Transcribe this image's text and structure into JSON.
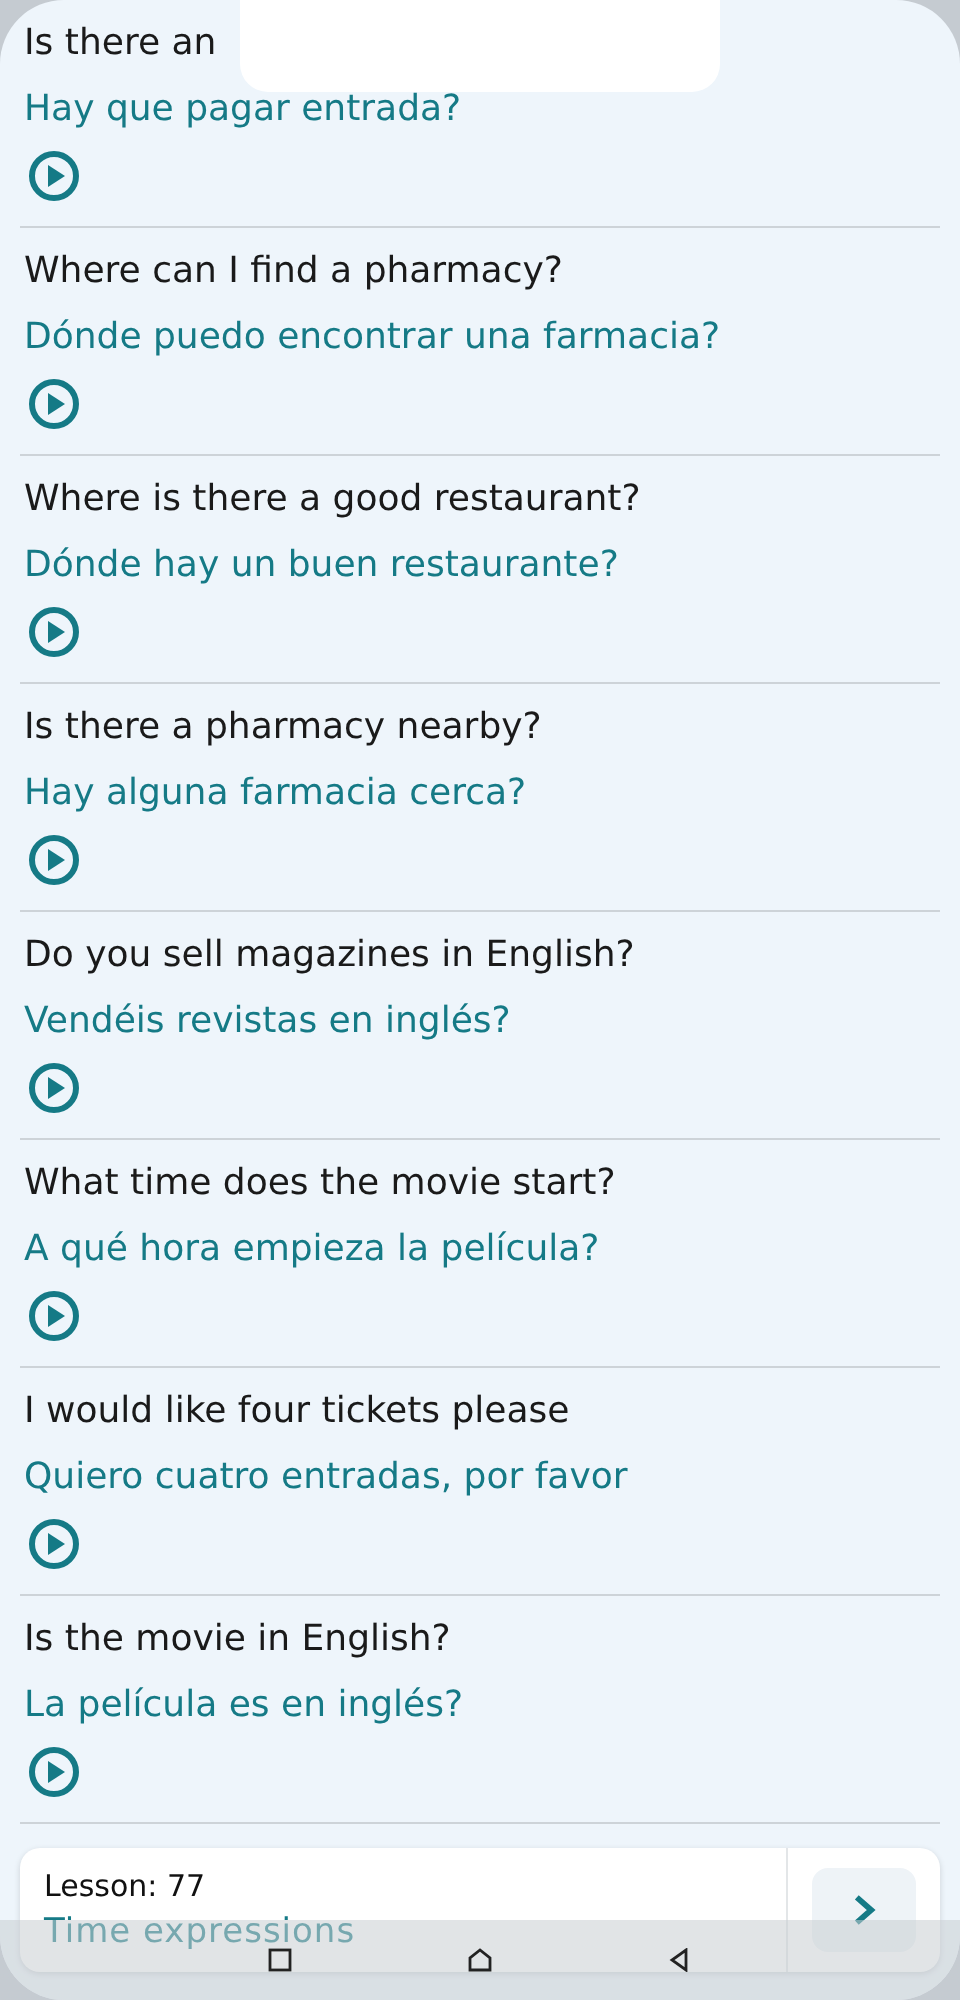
{
  "phrases": [
    {
      "english": "Is there an",
      "spanish": "Hay que pagar entrada?"
    },
    {
      "english": "Where can I find a pharmacy?",
      "spanish": "Dónde puedo encontrar una farmacia?"
    },
    {
      "english": "Where is there a good restaurant?",
      "spanish": "Dónde hay un buen restaurante?"
    },
    {
      "english": "Is there a pharmacy nearby?",
      "spanish": "Hay alguna farmacia cerca?"
    },
    {
      "english": "Do you sell magazines in English?",
      "spanish": "Vendéis revistas en inglés?"
    },
    {
      "english": "What time does the movie start?",
      "spanish": "A qué hora empieza la película?"
    },
    {
      "english": "I would like four tickets please",
      "spanish": "Quiero cuatro entradas, por favor"
    },
    {
      "english": "Is the movie in English?",
      "spanish": "La película es en inglés?"
    }
  ],
  "lesson": {
    "number": "Lesson: 77",
    "title": "Time expressions"
  }
}
